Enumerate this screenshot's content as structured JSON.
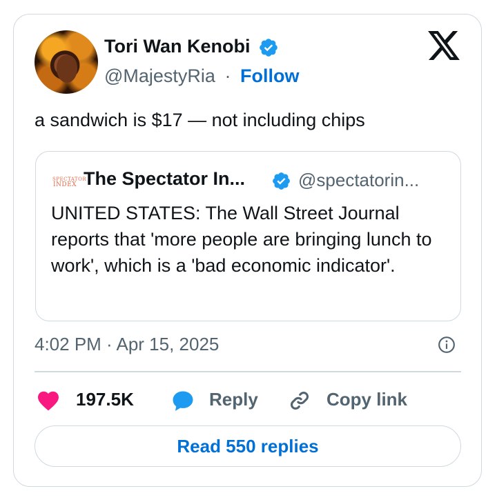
{
  "colors": {
    "text": "#0f1419",
    "secondary": "#536471",
    "link": "#006fd6",
    "verified": "#1d9bf0",
    "like": "#f91880",
    "reply": "#1d9bf0",
    "border": "#cfd9de"
  },
  "author": {
    "name": "Tori Wan Kenobi",
    "handle": "@MajestyRia",
    "separator": "·",
    "follow_label": "Follow",
    "verified_icon": "verified-badge-icon",
    "avatar": "avatar-photo"
  },
  "platform_icon": "x-logo-icon",
  "tweet": {
    "text": "a sandwich is $17 — not including chips"
  },
  "quoted": {
    "logo_line1": "SPECTATOR",
    "logo_line2": "INDEX",
    "name": "The Spectator In...",
    "handle": "@spectatorin...",
    "body": "UNITED STATES: The Wall Street Journal reports that 'more people are bringing lunch to work', which is a 'bad economic indicator'."
  },
  "timestamp": "4:02 PM · Apr 15, 2025",
  "actions": {
    "likes": "197.5K",
    "reply_label": "Reply",
    "copy_label": "Copy link"
  },
  "read_replies_label": "Read 550 replies"
}
